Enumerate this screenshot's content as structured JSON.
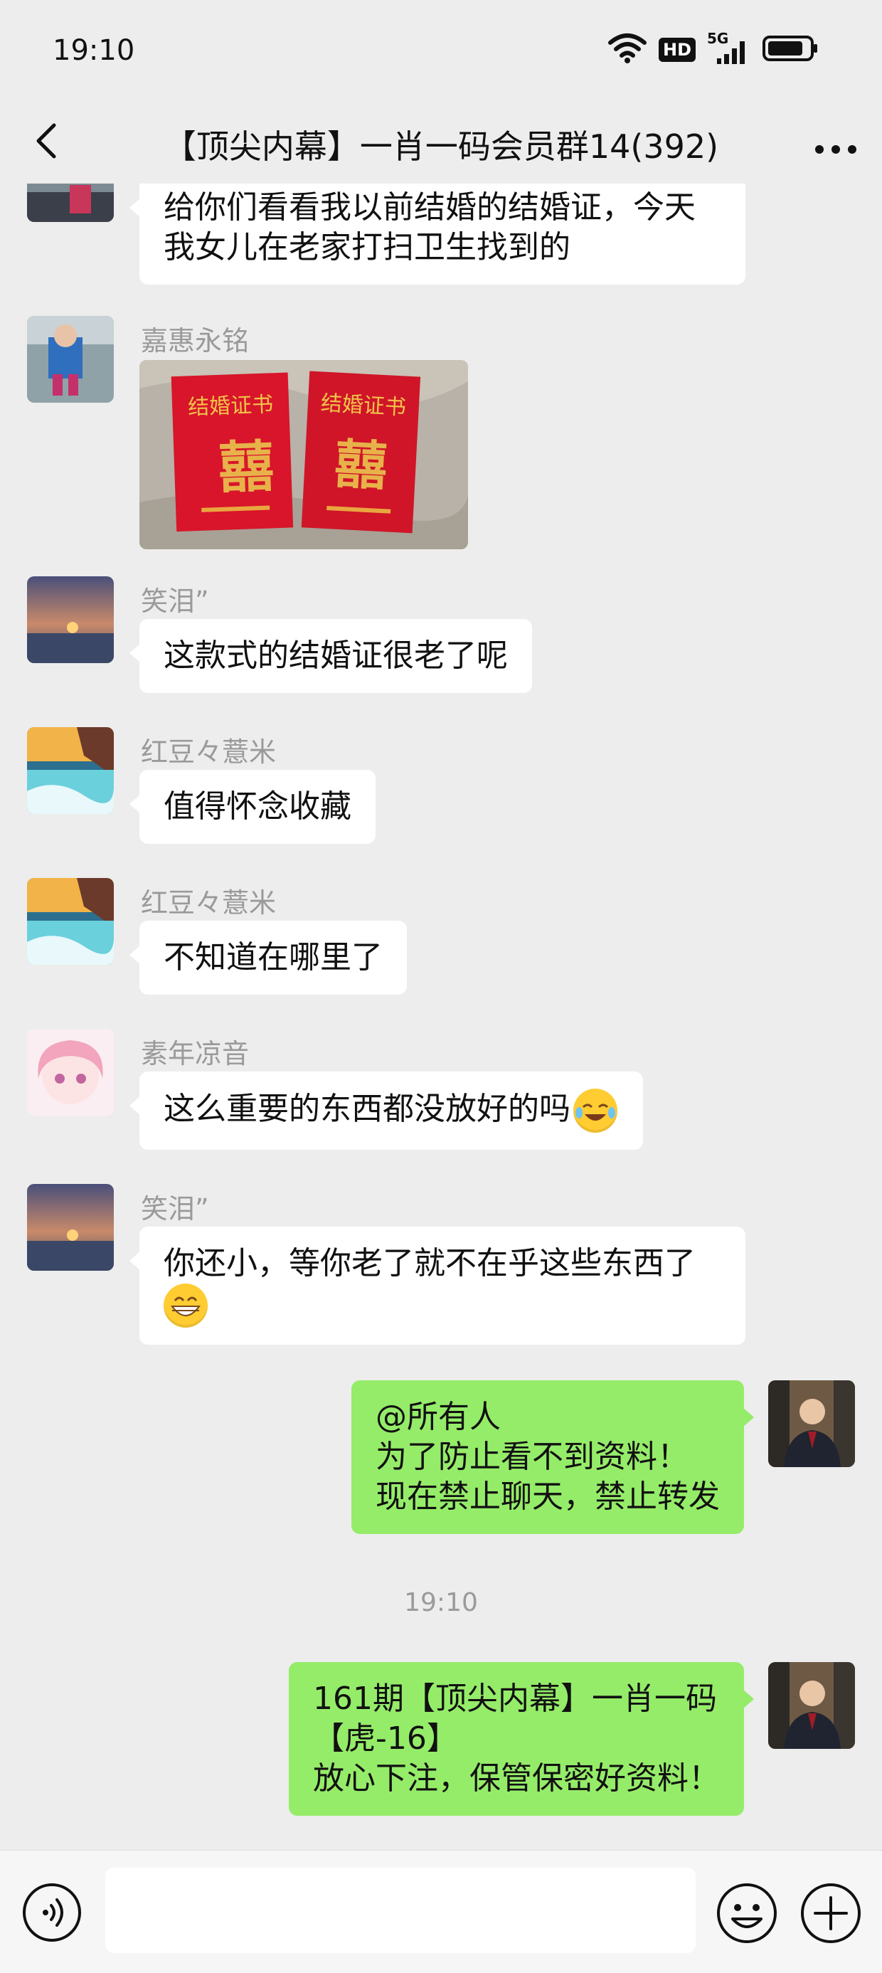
{
  "status_bar": {
    "time": "19:10",
    "hd": "HD",
    "net": "5G"
  },
  "header": {
    "title": "【顶尖内幕】一肖一码会员群14(392)"
  },
  "messages": {
    "m1": {
      "lines": [
        "给你们看看我以前结婚的结婚证，今天",
        "我女儿在老家打扫卫生找到的"
      ]
    },
    "m2": {
      "sender": "嘉惠永铭",
      "photo_text_left": "结婚证书",
      "photo_text_right": "结婚证书"
    },
    "m3": {
      "sender": "笑泪”",
      "text": "这款式的结婚证很老了呢"
    },
    "m4": {
      "sender": "红豆々薏米",
      "text": "值得怀念收藏"
    },
    "m5": {
      "sender": "红豆々薏米",
      "text": "不知道在哪里了"
    },
    "m6": {
      "sender": "素年凉音",
      "text": "这么重要的东西都没放好的吗"
    },
    "m7": {
      "sender": "笑泪”",
      "line1": "你还小，等你老了就不在乎这些东西了"
    },
    "m8": {
      "lines": [
        "@所有人",
        "为了防止看不到资料！",
        "现在禁止聊天，禁止转发"
      ]
    },
    "timestamp": "19:10",
    "m9": {
      "lines": [
        "161期【顶尖内幕】一肖一码",
        "【虎-16】",
        "放心下注，保管保密好资料！"
      ]
    }
  },
  "input": {
    "placeholder": ""
  },
  "colors": {
    "background": "#ededed",
    "self_bubble": "#95ec69",
    "other_bubble": "#ffffff",
    "sender_name": "#9a9a9a"
  }
}
